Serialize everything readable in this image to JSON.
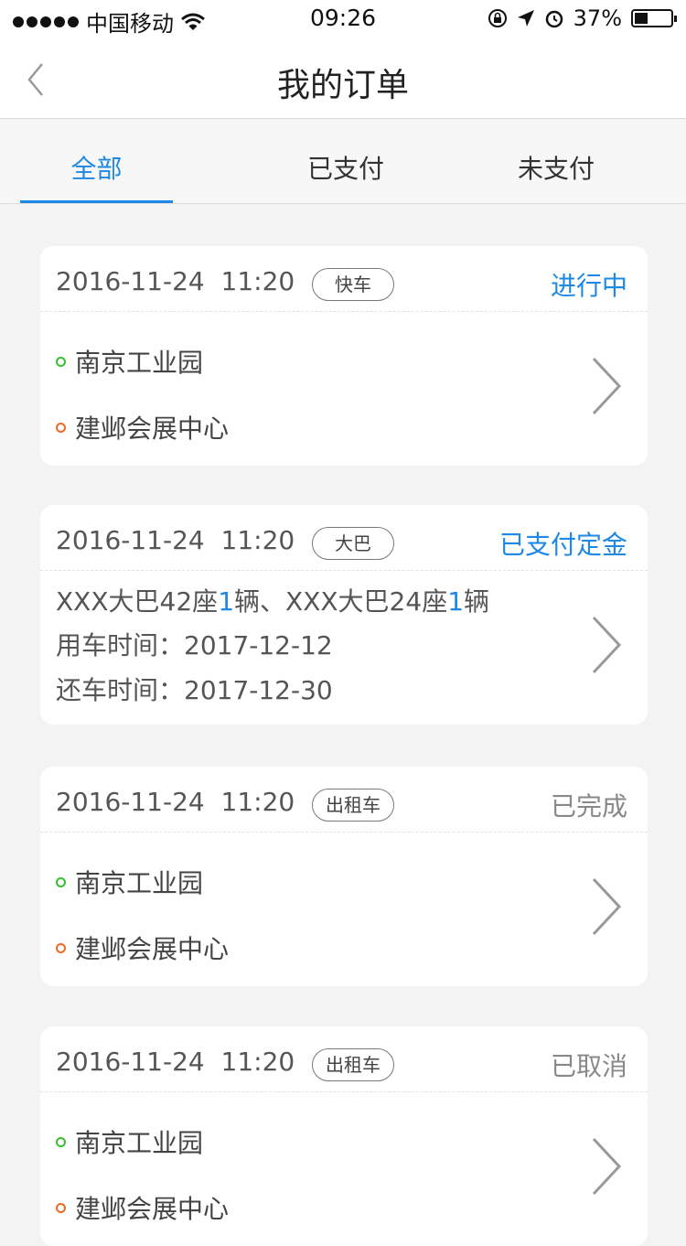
{
  "status_bar": {
    "carrier": "中国移动",
    "time": "09:26",
    "battery": "37%",
    "battery_level": 0.37
  },
  "nav": {
    "title": "我的订单"
  },
  "tabs": [
    {
      "label": "全部",
      "active": true
    },
    {
      "label": "已支付",
      "active": false
    },
    {
      "label": "未支付",
      "active": false
    }
  ],
  "orders": [
    {
      "date": "2016-11-24  11:20",
      "type": "快车",
      "status": "进行中",
      "from": "南京工业园",
      "to": "建邺会展中心"
    },
    {
      "date": "2016-11-24  11:20",
      "type": "大巴",
      "status": "已支付定金",
      "bus_part1": "XXX大巴42座",
      "bus_count1": "1",
      "bus_part2": "辆、XXX大巴24座",
      "bus_count2": "1",
      "bus_part3": "辆",
      "use_time": "用车时间：2017-12-12",
      "return_time": "还车时间：2017-12-30"
    },
    {
      "date": "2016-11-24  11:20",
      "type": "出租车",
      "status": "已完成",
      "from": "南京工业园",
      "to": "建邺会展中心"
    },
    {
      "date": "2016-11-24  11:20",
      "type": "出租车",
      "status": "已取消",
      "from": "南京工业园",
      "to": "建邺会展中心"
    }
  ],
  "colors": {
    "accent": "#1e88e5",
    "start_dot": "#38c02c",
    "end_dot": "#f06a24"
  }
}
